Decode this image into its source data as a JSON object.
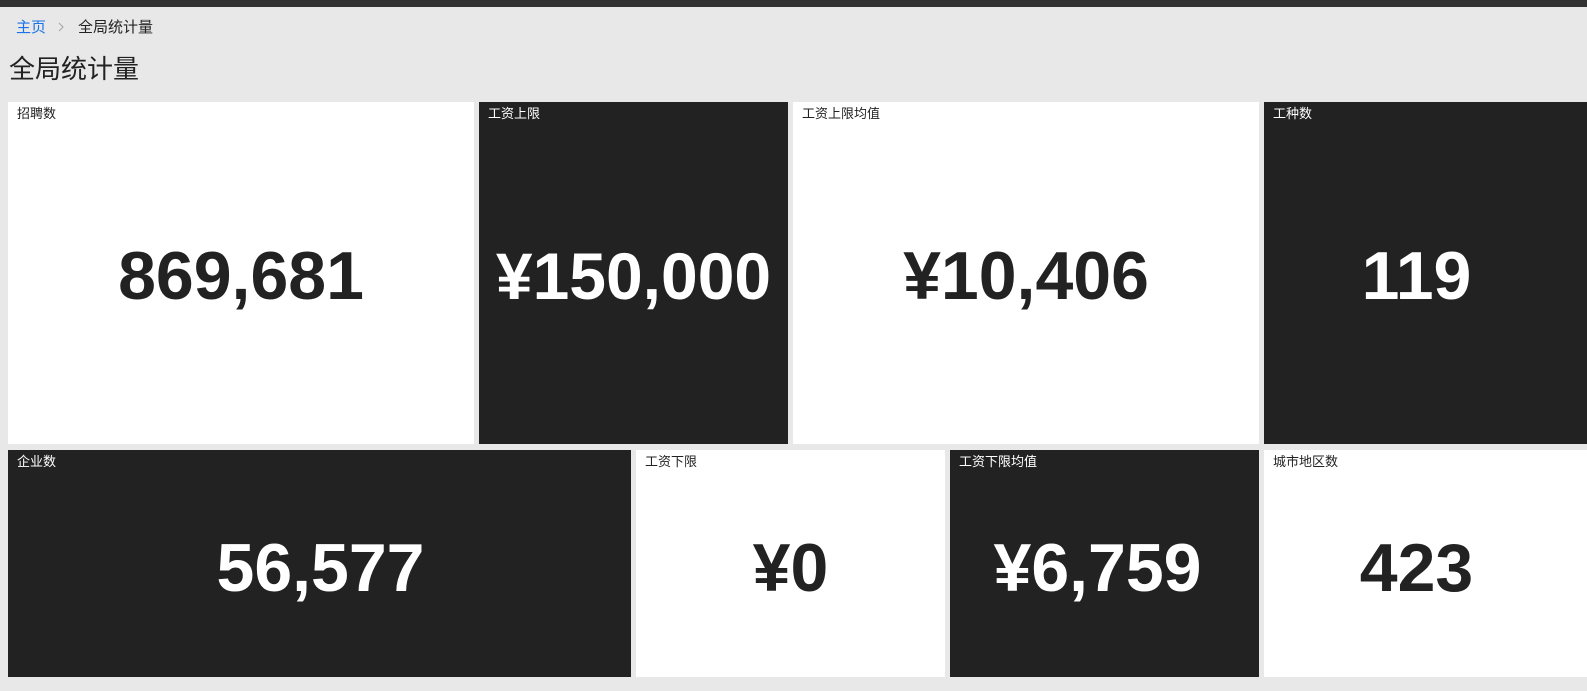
{
  "breadcrumb": {
    "home": "主页",
    "separator_icon": "chevron-right-icon",
    "current": "全局统计量"
  },
  "page_title": "全局统计量",
  "colors": {
    "light_tile": "#ffffff",
    "dark_tile": "#222222",
    "link": "#1a73e8",
    "background": "#e8e8e8",
    "topbar": "#323232"
  },
  "stats": [
    {
      "label": "招聘数",
      "value": "869,681",
      "theme": "light"
    },
    {
      "label": "工资上限",
      "value": "¥150,000",
      "theme": "dark"
    },
    {
      "label": "工资上限均值",
      "value": "¥10,406",
      "theme": "light"
    },
    {
      "label": "工种数",
      "value": "119",
      "theme": "dark"
    },
    {
      "label": "企业数",
      "value": "56,577",
      "theme": "dark"
    },
    {
      "label": "工资下限",
      "value": "¥0",
      "theme": "light"
    },
    {
      "label": "工资下限均值",
      "value": "¥6,759",
      "theme": "dark"
    },
    {
      "label": "城市地区数",
      "value": "423",
      "theme": "light"
    }
  ]
}
